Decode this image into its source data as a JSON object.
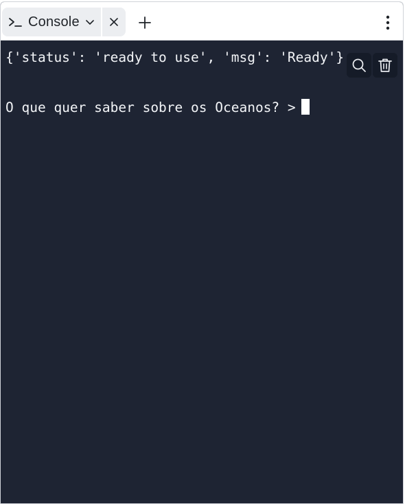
{
  "tab": {
    "label": "Console",
    "icon": "terminal-prompt-icon"
  },
  "toolbar": {
    "add_icon": "plus-icon",
    "menu_icon": "kebab-menu-icon"
  },
  "console": {
    "output_line": "{'status': 'ready to use', 'msg': 'Ready'}",
    "prompt_line": "O que quer saber sobre os Oceanos? >",
    "search_icon": "search-icon",
    "clear_icon": "trash-icon",
    "background": "#1e2433"
  }
}
